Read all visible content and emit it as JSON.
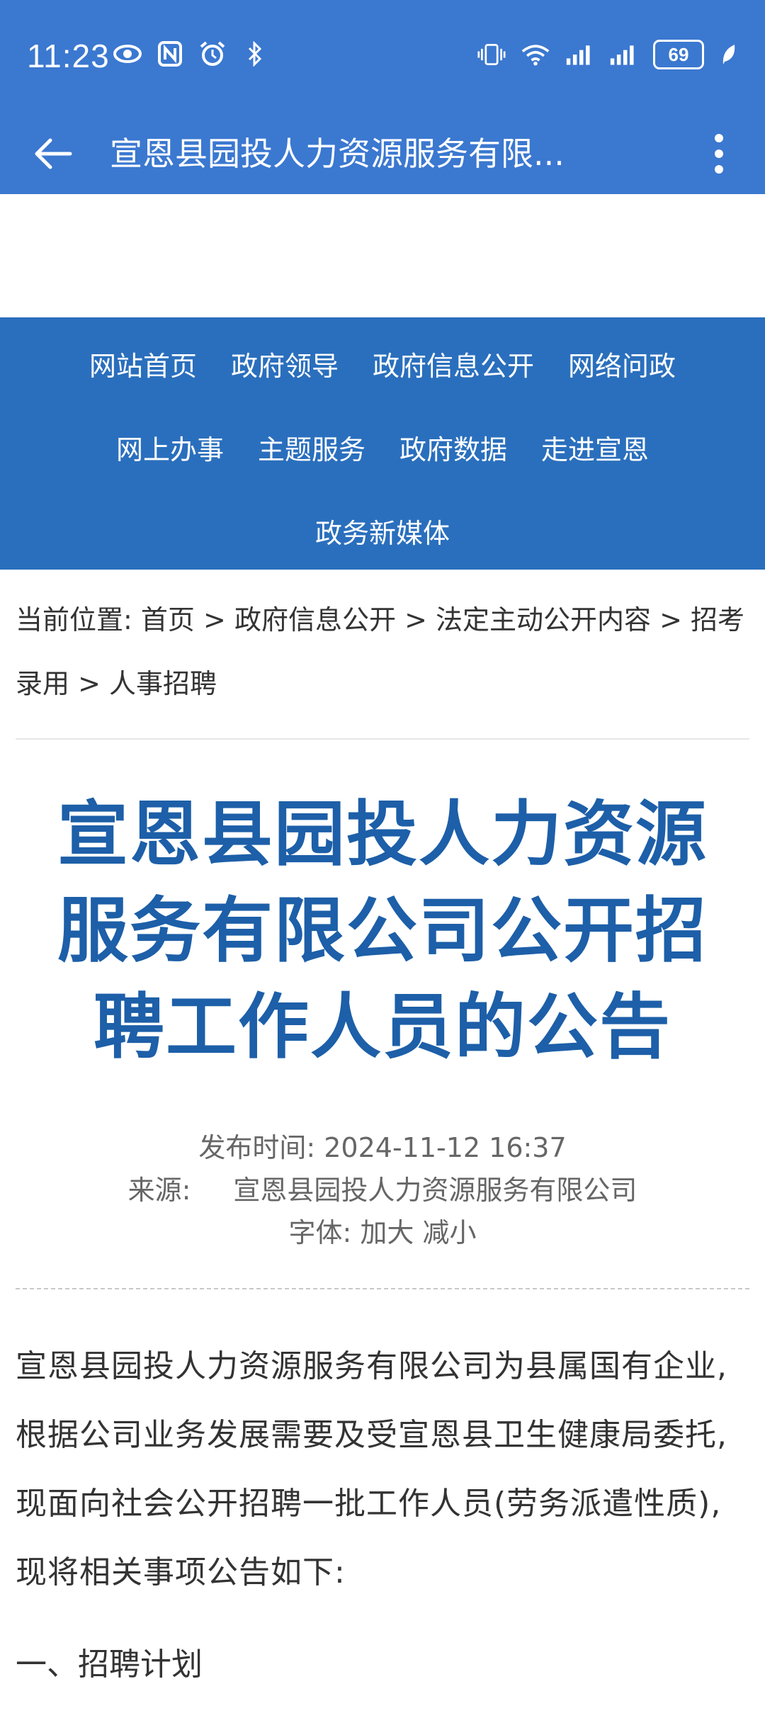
{
  "status_bar": {
    "time": "11:23",
    "battery": "69",
    "left_icons": [
      "eye-icon",
      "nfc-icon",
      "alarm-icon",
      "bluetooth-icon"
    ],
    "right_icons": [
      "vibrate-icon",
      "wifi-icon",
      "signal-icon",
      "signal-icon",
      "battery-icon",
      "leaf-icon"
    ]
  },
  "app_bar": {
    "title": "宣恩县园投人力资源服务有限...",
    "back_icon": "arrow-back-icon",
    "more_icon": "more-vert-icon"
  },
  "nav": {
    "row1": [
      "网站首页",
      "政府领导",
      "政府信息公开",
      "网络问政"
    ],
    "row2": [
      "网上办事",
      "主题服务",
      "政府数据",
      "走进宣恩"
    ],
    "row3": [
      "政务新媒体"
    ]
  },
  "breadcrumb": {
    "prefix": "当前位置:",
    "items": [
      "首页",
      "政府信息公开",
      "法定主动公开内容",
      "招考录用",
      "人事招聘"
    ],
    "separator": ">"
  },
  "article": {
    "title": "宣恩县园投人力资源服务有限公司公开招聘工作人员的公告",
    "publish_label": "发布时间:",
    "publish_time": "2024-11-12 16:37",
    "source_label": "来源:",
    "source": "宣恩县园投人力资源服务有限公司",
    "font_label": "字体:",
    "font_larger": "加大",
    "font_smaller": "减小",
    "paragraph": "宣恩县园投人力资源服务有限公司为县属国有企业,根据公司业务发展需要及受宣恩县卫生健康局委托,现面向社会公开招聘一批工作人员(劳务派遣性质),现将相关事项公告如下:",
    "section1": "一、招聘计划"
  },
  "colors": {
    "status_bar": "#3b78d0",
    "nav_bg": "#2a6fbd",
    "headline": "#1d5fa8"
  }
}
